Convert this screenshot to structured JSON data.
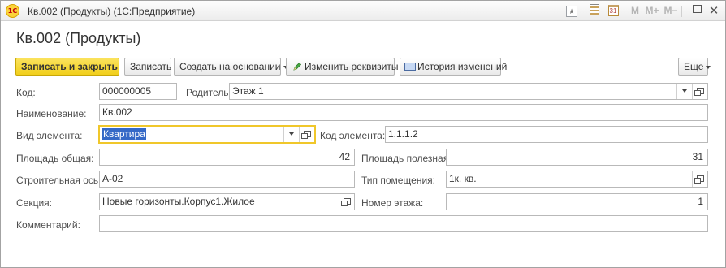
{
  "window": {
    "title": "Кв.002 (Продукты)  (1С:Предприятие)",
    "logo_text": "1С",
    "buttons": {
      "m": "M",
      "m_plus": "M+",
      "m_minus": "M−",
      "close": "✕",
      "calendar_day": "31"
    }
  },
  "form": {
    "title": "Кв.002 (Продукты)"
  },
  "toolbar": {
    "save_close": "Записать и закрыть",
    "save": "Записать",
    "create_based": "Создать на основании",
    "edit_details": "Изменить реквизиты",
    "history": "История изменений",
    "more": "Еще"
  },
  "fields": {
    "code": {
      "label": "Код:",
      "value": "000000005"
    },
    "parent": {
      "label": "Родитель:",
      "value": "Этаж 1"
    },
    "name": {
      "label": "Наименование:",
      "value": "Кв.002"
    },
    "element_type": {
      "label": "Вид элемента:",
      "value": "Квартира"
    },
    "element_code": {
      "label": "Код элемента:",
      "value": "1.1.1.2"
    },
    "total_area": {
      "label": "Площадь общая:",
      "value": "42"
    },
    "useful_area": {
      "label": "Площадь полезная:",
      "value": "31"
    },
    "building_axis": {
      "label": "Строительная ось:",
      "value": "А-02"
    },
    "room_type": {
      "label": "Тип помещения:",
      "value": "1к. кв."
    },
    "section": {
      "label": "Секция:",
      "value": "Новые горизонты.Корпус1.Жилое"
    },
    "floor_number": {
      "label": "Номер этажа:",
      "value": "1"
    },
    "comment": {
      "label": "Комментарий:",
      "value": ""
    }
  }
}
